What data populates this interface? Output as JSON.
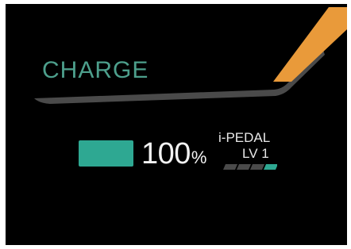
{
  "display": {
    "mode_label": "CHARGE",
    "battery": {
      "value": "100",
      "unit": "%"
    },
    "i_pedal": {
      "title": "i-PEDAL",
      "level": "LV 1",
      "level_active_segments": 1,
      "level_total_segments": 4
    }
  },
  "colors": {
    "background": "#000000",
    "mode_label": "#4d9f8c",
    "battery_fill": "#2ea892",
    "accent_orange": "#e99a3a",
    "sweep_gray": "#4a4a4a",
    "meter_inactive": "#4a4a4a",
    "meter_active": "#2ea892"
  }
}
